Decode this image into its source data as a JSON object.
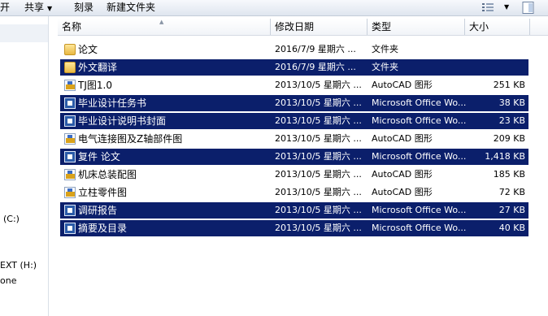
{
  "toolbar": {
    "open_label": "开",
    "share_label": "共享",
    "burn_label": "刻录",
    "new_folder_label": "新建文件夹"
  },
  "nav": {
    "items": [
      {
        "label": "(C:)"
      },
      {
        "label": "EXT (H:)"
      },
      {
        "label": "one"
      }
    ]
  },
  "columns": {
    "name": "名称",
    "date": "修改日期",
    "type": "类型",
    "size": "大小"
  },
  "files": [
    {
      "name": "论文",
      "date": "2016/7/9 星期六 ...",
      "type": "文件夹",
      "size": "",
      "icon": "folder-icon",
      "selected": false
    },
    {
      "name": "外文翻译",
      "date": "2016/7/9 星期六 ...",
      "type": "文件夹",
      "size": "",
      "icon": "folder-icon",
      "selected": true
    },
    {
      "name": "TJ图1.0",
      "date": "2013/10/5 星期六 ...",
      "type": "AutoCAD 图形",
      "size": "251 KB",
      "icon": "autocad-file-icon",
      "selected": false
    },
    {
      "name": "毕业设计任务书",
      "date": "2013/10/5 星期六 ...",
      "type": "Microsoft Office Wo...",
      "size": "38 KB",
      "icon": "word-file-icon",
      "selected": true
    },
    {
      "name": "毕业设计说明书封面",
      "date": "2013/10/5 星期六 ...",
      "type": "Microsoft Office Wo...",
      "size": "23 KB",
      "icon": "word-file-icon",
      "selected": true
    },
    {
      "name": "电气连接图及Z轴部件图",
      "date": "2013/10/5 星期六 ...",
      "type": "AutoCAD 图形",
      "size": "209 KB",
      "icon": "autocad-file-icon",
      "selected": false
    },
    {
      "name": "复件 论文",
      "date": "2013/10/5 星期六 ...",
      "type": "Microsoft Office Wo...",
      "size": "1,418 KB",
      "icon": "word-file-icon",
      "selected": true
    },
    {
      "name": "机床总装配图",
      "date": "2013/10/5 星期六 ...",
      "type": "AutoCAD 图形",
      "size": "185 KB",
      "icon": "autocad-file-icon",
      "selected": false
    },
    {
      "name": "立柱零件图",
      "date": "2013/10/5 星期六 ...",
      "type": "AutoCAD 图形",
      "size": "72 KB",
      "icon": "autocad-file-icon",
      "selected": false
    },
    {
      "name": "调研报告",
      "date": "2013/10/5 星期六 ...",
      "type": "Microsoft Office Wo...",
      "size": "27 KB",
      "icon": "word-file-icon",
      "selected": true
    },
    {
      "name": "摘要及目录",
      "date": "2013/10/5 星期六 ...",
      "type": "Microsoft Office Wo...",
      "size": "40 KB",
      "icon": "word-file-icon",
      "selected": true
    }
  ],
  "colors": {
    "selection": "#0b1f6b",
    "selection_text": "#ffffff"
  }
}
